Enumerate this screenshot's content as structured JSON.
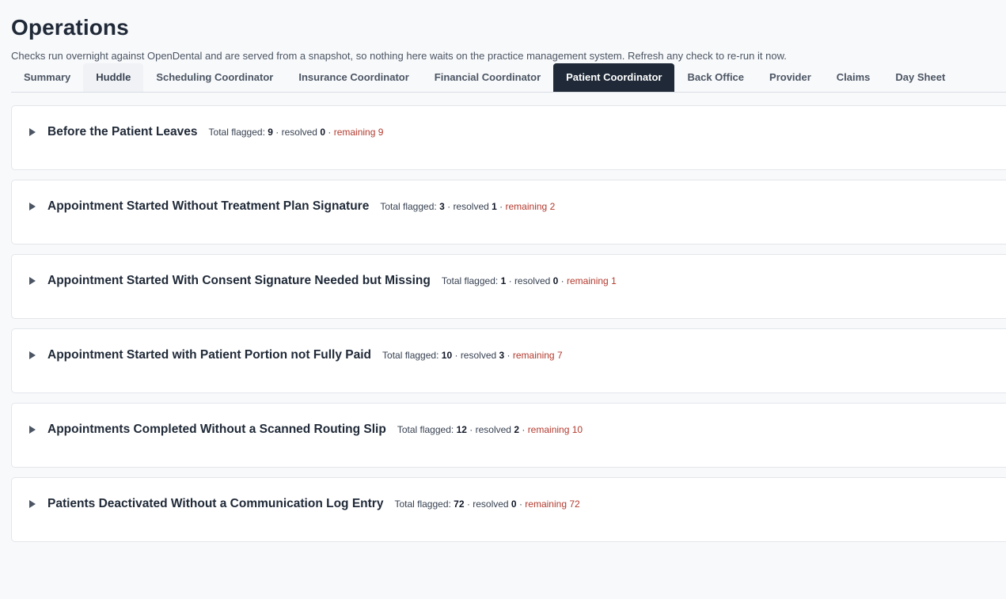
{
  "header": {
    "title": "Operations",
    "subtitle": "Checks run overnight against OpenDental and are served from a snapshot, so nothing here waits on the practice management system. Refresh any check to re-run it now."
  },
  "tabs": [
    {
      "label": "Summary"
    },
    {
      "label": "Huddle"
    },
    {
      "label": "Scheduling Coordinator"
    },
    {
      "label": "Insurance Coordinator"
    },
    {
      "label": "Financial Coordinator"
    },
    {
      "label": "Patient Coordinator"
    },
    {
      "label": "Back Office"
    },
    {
      "label": "Provider"
    },
    {
      "label": "Claims"
    },
    {
      "label": "Day Sheet"
    }
  ],
  "active_tab": "Patient Coordinator",
  "meta_labels": {
    "total": "Total flagged:",
    "sep": "·",
    "resolved": "resolved",
    "remaining": "remaining"
  },
  "sections": [
    {
      "title": "Before the Patient Leaves",
      "total": "9",
      "resolved": "0",
      "remaining": "9"
    },
    {
      "title": "Appointment Started Without Treatment Plan Signature",
      "total": "3",
      "resolved": "1",
      "remaining": "2"
    },
    {
      "title": "Appointment Started With Consent Signature Needed but Missing",
      "total": "1",
      "resolved": "0",
      "remaining": "1"
    },
    {
      "title": "Appointment Started with Patient Portion not Fully Paid",
      "total": "10",
      "resolved": "3",
      "remaining": "7"
    },
    {
      "title": "Appointments Completed Without a Scanned Routing Slip",
      "total": "12",
      "resolved": "2",
      "remaining": "10"
    },
    {
      "title": "Patients Deactivated Without a Communication Log Entry",
      "total": "72",
      "resolved": "0",
      "remaining": "72"
    }
  ],
  "colors": {
    "active_tab_bg": "#1f2937",
    "remaining_text": "#b33a2e",
    "page_bg": "#f8f9fb"
  }
}
